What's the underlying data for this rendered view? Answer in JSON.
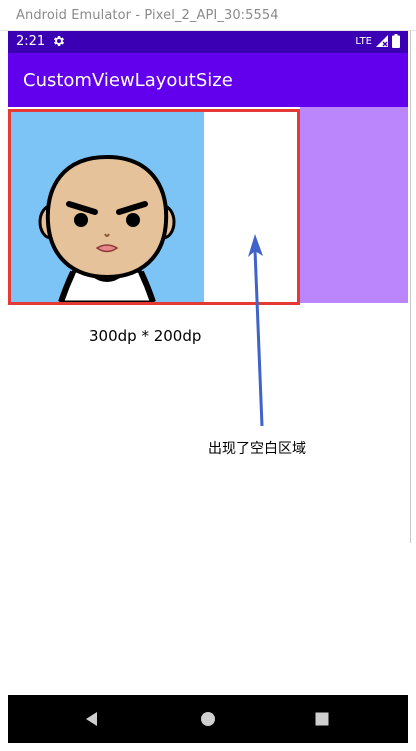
{
  "window": {
    "title": "Android Emulator - Pixel_2_API_30:5554"
  },
  "status_bar": {
    "time": "2:21",
    "network": "LTE",
    "icons": [
      "gear-icon",
      "signal-icon",
      "battery-icon"
    ]
  },
  "app_bar": {
    "title": "CustomViewLayoutSize"
  },
  "content": {
    "size_caption": "300dp * 200dp",
    "annotation": "出现了空白区域"
  },
  "nav": {
    "icons": [
      "back-icon",
      "home-icon",
      "recents-icon"
    ]
  },
  "colors": {
    "status_bar": "#3b00b3",
    "app_bar": "#6200ee",
    "purple_block": "#bb86fc",
    "border": "#e53935",
    "avatar_bg": "#7cc3f6",
    "arrow": "#3f63c9"
  }
}
